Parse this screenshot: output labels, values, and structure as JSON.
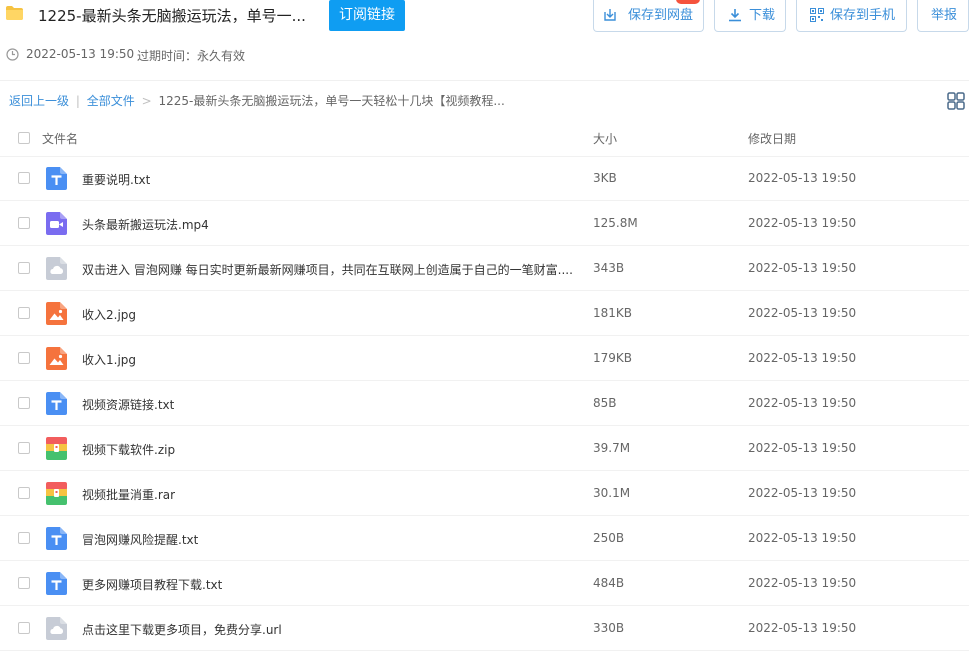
{
  "header": {
    "title": "1225-最新头条无脑搬运玩法，单号一...",
    "subscribe_label": "订阅链接",
    "save_label": "保存到网盘",
    "download_label": "下载",
    "save_phone_label": "保存到手机",
    "report_label": "举报",
    "share_date": "2022-05-13 19:50",
    "expire_text": "过期时间：永久有效"
  },
  "breadcrumb": {
    "back_label": "返回上一级",
    "separator": "|",
    "all_files_label": "全部文件",
    "arrow": ">",
    "current": "1225-最新头条无脑搬运玩法，单号一天轻松十几块【视频教程..."
  },
  "table": {
    "columns": {
      "name": "文件名",
      "size": "大小",
      "date": "修改日期"
    },
    "rows": [
      {
        "name": "重要说明.txt",
        "size": "3KB",
        "date": "2022-05-13 19:50",
        "icon": "txt"
      },
      {
        "name": "头条最新搬运玩法.mp4",
        "size": "125.8M",
        "date": "2022-05-13 19:50",
        "icon": "video"
      },
      {
        "name": "双击进入 冒泡网赚 每日实时更新最新网赚项目，共同在互联网上创造属于自己的一笔财富....",
        "size": "343B",
        "date": "2022-05-13 19:50",
        "icon": "cloud"
      },
      {
        "name": "收入2.jpg",
        "size": "181KB",
        "date": "2022-05-13 19:50",
        "icon": "image"
      },
      {
        "name": "收入1.jpg",
        "size": "179KB",
        "date": "2022-05-13 19:50",
        "icon": "image"
      },
      {
        "name": "视频资源链接.txt",
        "size": "85B",
        "date": "2022-05-13 19:50",
        "icon": "txt"
      },
      {
        "name": "视频下载软件.zip",
        "size": "39.7M",
        "date": "2022-05-13 19:50",
        "icon": "zip"
      },
      {
        "name": "视频批量消重.rar",
        "size": "30.1M",
        "date": "2022-05-13 19:50",
        "icon": "zip"
      },
      {
        "name": "冒泡网赚风险提醒.txt",
        "size": "250B",
        "date": "2022-05-13 19:50",
        "icon": "txt"
      },
      {
        "name": "更多网赚项目教程下载.txt",
        "size": "484B",
        "date": "2022-05-13 19:50",
        "icon": "txt"
      },
      {
        "name": "点击这里下载更多项目，免费分享.url",
        "size": "330B",
        "date": "2022-05-13 19:50",
        "icon": "cloud"
      }
    ]
  },
  "colors": {
    "accent": "#3b8fd9",
    "subscribe": "#0f9df2",
    "txt_icon": "#4a8ff3",
    "video_icon": "#7a6cf0",
    "image_icon": "#f5733d",
    "cloud_icon": "#c7ccd6"
  }
}
